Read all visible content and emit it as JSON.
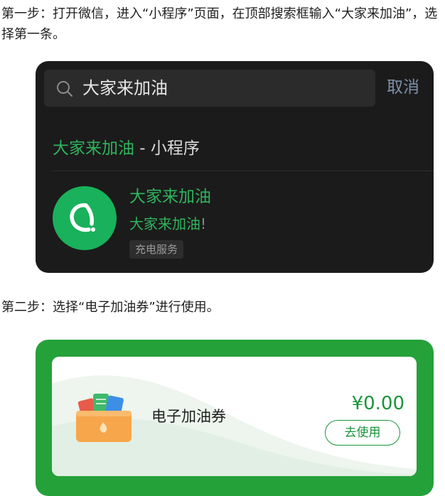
{
  "steps": {
    "step1": "第一步：打开微信，进入“小程序”页面，在顶部搜索框输入“大家来加油”，选择第一条。",
    "step2": "第二步：选择“电子加油券”进行使用。"
  },
  "search": {
    "query": "大家来加油",
    "cancel_label": "取消",
    "section_highlight": "大家来加油",
    "section_suffix": " - 小程序",
    "result": {
      "name": "大家来加油",
      "desc_main": "大家来加油",
      "desc_tail": "!",
      "tag": "充电服务"
    },
    "colors": {
      "accent": "#2fb45c",
      "logo_bg": "#19b15b",
      "panel_bg": "#1b1b1b"
    }
  },
  "coupon": {
    "title": "电子加油券",
    "amount": "¥0.00",
    "button_label": "去使用",
    "colors": {
      "frame": "#25a13a",
      "accent": "#19953a"
    }
  },
  "icons": [
    "search-icon",
    "app-logo-icon",
    "coupon-wallet-icon"
  ]
}
